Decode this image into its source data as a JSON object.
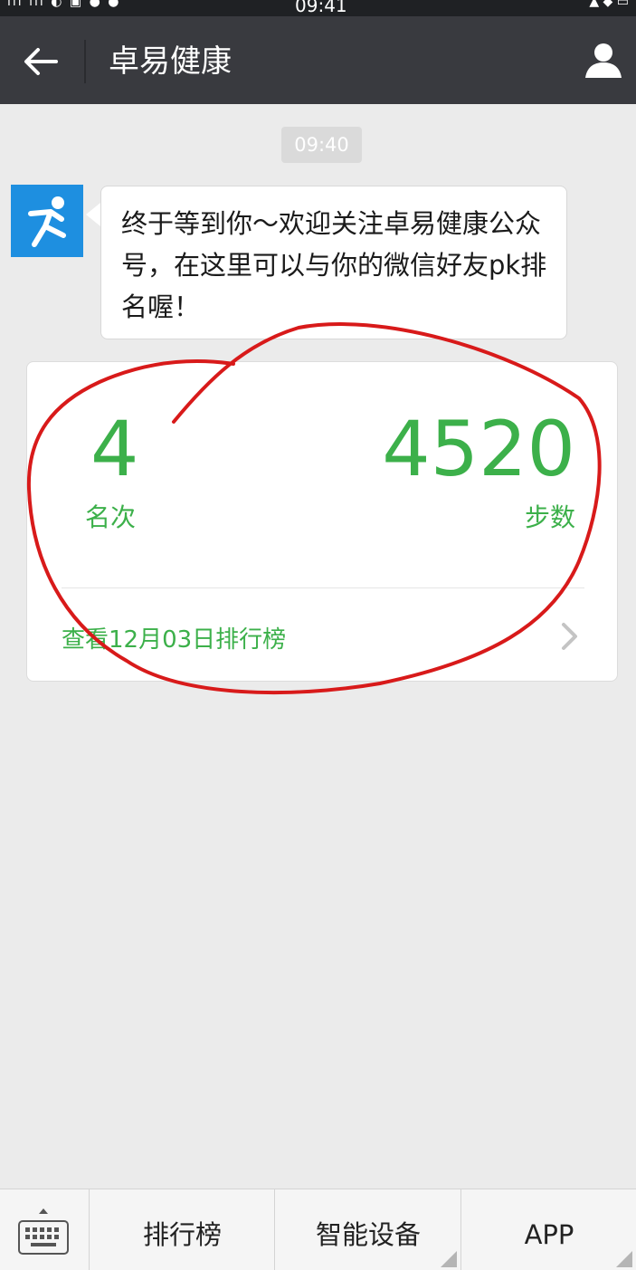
{
  "status_bar": {
    "time": "09:41"
  },
  "header": {
    "title": "卓易健康"
  },
  "chat": {
    "timestamp": "09:40",
    "message": "终于等到你～欢迎关注卓易健康公众号，在这里可以与你的微信好友pk排名喔！"
  },
  "card": {
    "rank_value": "4",
    "rank_label": "名次",
    "steps_value": "4520",
    "steps_label": "步数",
    "link_text": "查看12月03日排行榜"
  },
  "bottom_menu": {
    "items": [
      {
        "label": "排行榜"
      },
      {
        "label": "智能设备"
      },
      {
        "label": "APP"
      }
    ]
  },
  "colors": {
    "accent": "#3cb04a",
    "titlebar": "#393a3f",
    "annotation": "#d81a1a"
  }
}
